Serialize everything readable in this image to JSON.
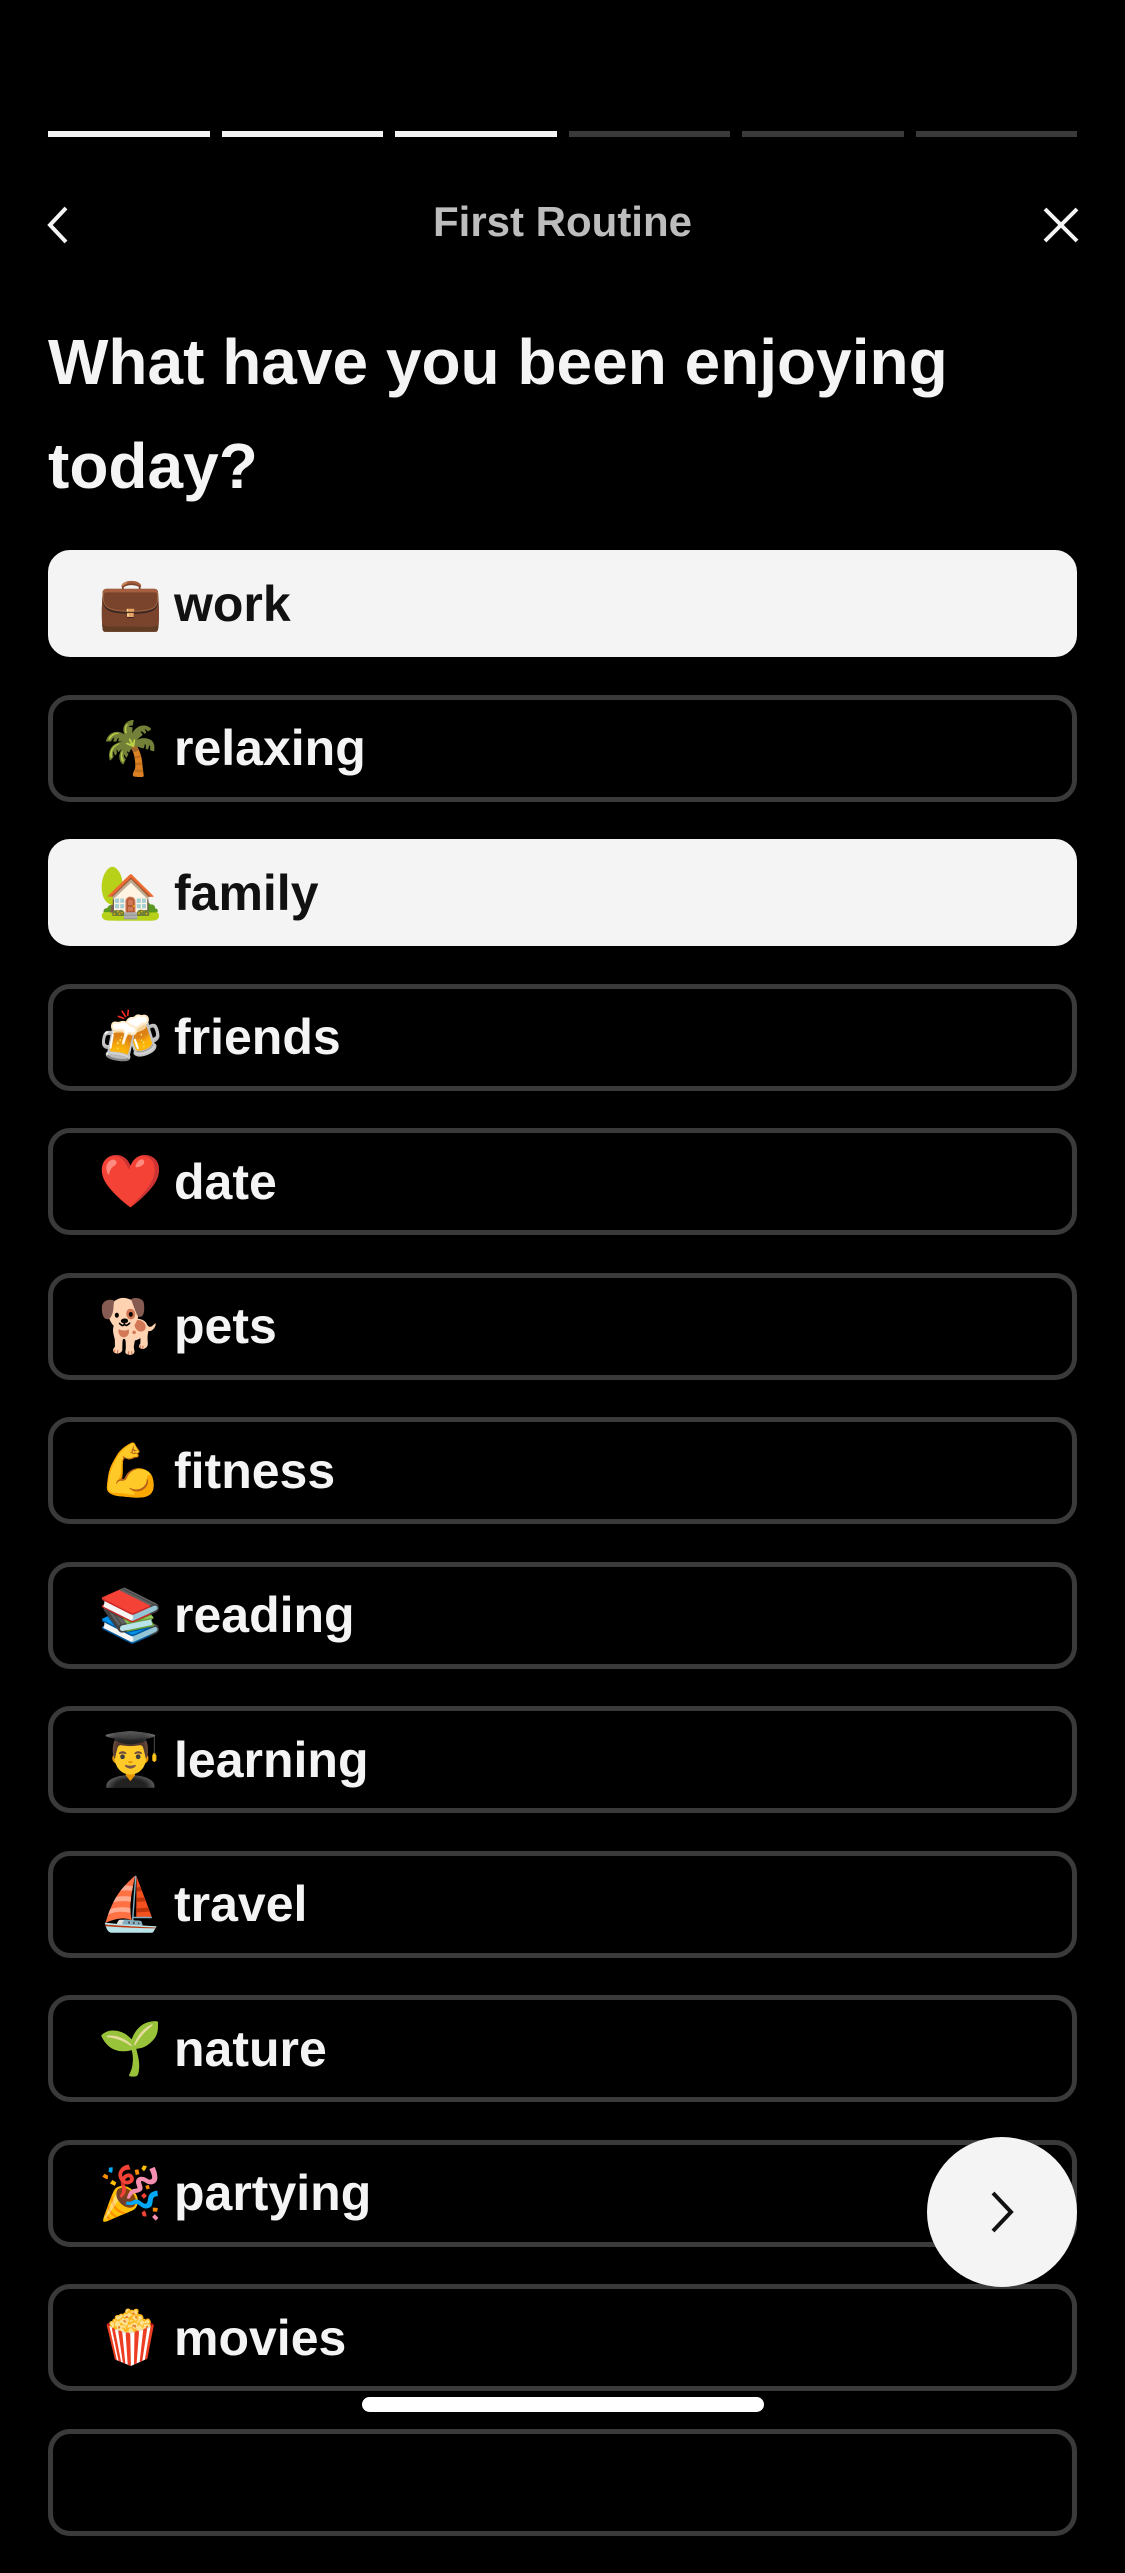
{
  "progress": {
    "total_steps": 6,
    "completed_steps": 3
  },
  "nav": {
    "title": "First Routine",
    "back_icon": "chevron-left-icon",
    "close_icon": "close-icon"
  },
  "question": "What have you been enjoying today?",
  "options": [
    {
      "emoji": "💼",
      "label": "work",
      "selected": true
    },
    {
      "emoji": "🌴",
      "label": "relaxing",
      "selected": false
    },
    {
      "emoji": "🏡",
      "label": "family",
      "selected": true
    },
    {
      "emoji": "🍻",
      "label": "friends",
      "selected": false
    },
    {
      "emoji": "❤️",
      "label": "date",
      "selected": false
    },
    {
      "emoji": "🐕",
      "label": "pets",
      "selected": false
    },
    {
      "emoji": "💪",
      "label": "fitness",
      "selected": false
    },
    {
      "emoji": "📚",
      "label": "reading",
      "selected": false
    },
    {
      "emoji": "👨‍🎓",
      "label": "learning",
      "selected": false
    },
    {
      "emoji": "⛵",
      "label": "travel",
      "selected": false
    },
    {
      "emoji": "🌱",
      "label": "nature",
      "selected": false
    },
    {
      "emoji": "🎉",
      "label": "partying",
      "selected": false
    },
    {
      "emoji": "🍿",
      "label": "movies",
      "selected": false
    },
    {
      "emoji": "",
      "label": "",
      "selected": false
    }
  ],
  "next_button": {
    "icon": "chevron-right-icon"
  }
}
